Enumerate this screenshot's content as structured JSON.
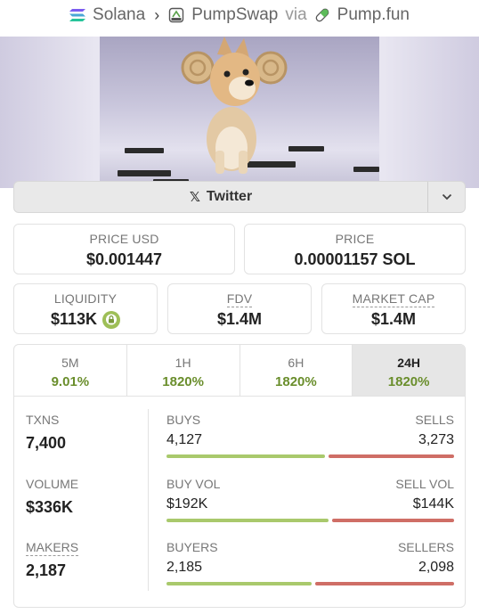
{
  "breadcrumb": {
    "chain": "Solana",
    "dex": "PumpSwap",
    "via": "via",
    "source": "Pump.fun"
  },
  "links": {
    "twitter_label": "Twitter"
  },
  "price_usd": {
    "label": "PRICE USD",
    "value": "$0.001447"
  },
  "price_native": {
    "label": "PRICE",
    "value": "0.00001157 SOL"
  },
  "liquidity": {
    "label": "LIQUIDITY",
    "value": "$113K"
  },
  "fdv": {
    "label": "FDV",
    "value": "$1.4M"
  },
  "market_cap": {
    "label": "MARKET CAP",
    "value": "$1.4M"
  },
  "tabs": [
    {
      "label": "5M",
      "value": "9.01%"
    },
    {
      "label": "1H",
      "value": "1820%"
    },
    {
      "label": "6H",
      "value": "1820%"
    },
    {
      "label": "24H",
      "value": "1820%"
    }
  ],
  "active_tab": "24H",
  "stats": {
    "txns": {
      "label": "TXNS",
      "value": "7,400",
      "left_label": "BUYS",
      "left_value": "4,127",
      "right_label": "SELLS",
      "right_value": "3,273",
      "left_fraction": 0.558
    },
    "volume": {
      "label": "VOLUME",
      "value": "$336K",
      "left_label": "BUY VOL",
      "left_value": "$192K",
      "right_label": "SELL VOL",
      "right_value": "$144K",
      "left_fraction": 0.571
    },
    "makers": {
      "label": "MAKERS",
      "value": "2,187",
      "left_label": "BUYERS",
      "left_value": "2,185",
      "right_label": "SELLERS",
      "right_value": "2,098",
      "left_fraction": 0.51
    }
  },
  "colors": {
    "positive": "#6a8e2c",
    "buy_bar": "#a9c96c",
    "sell_bar": "#cf6e66",
    "lock_badge": "#9ebf57"
  }
}
